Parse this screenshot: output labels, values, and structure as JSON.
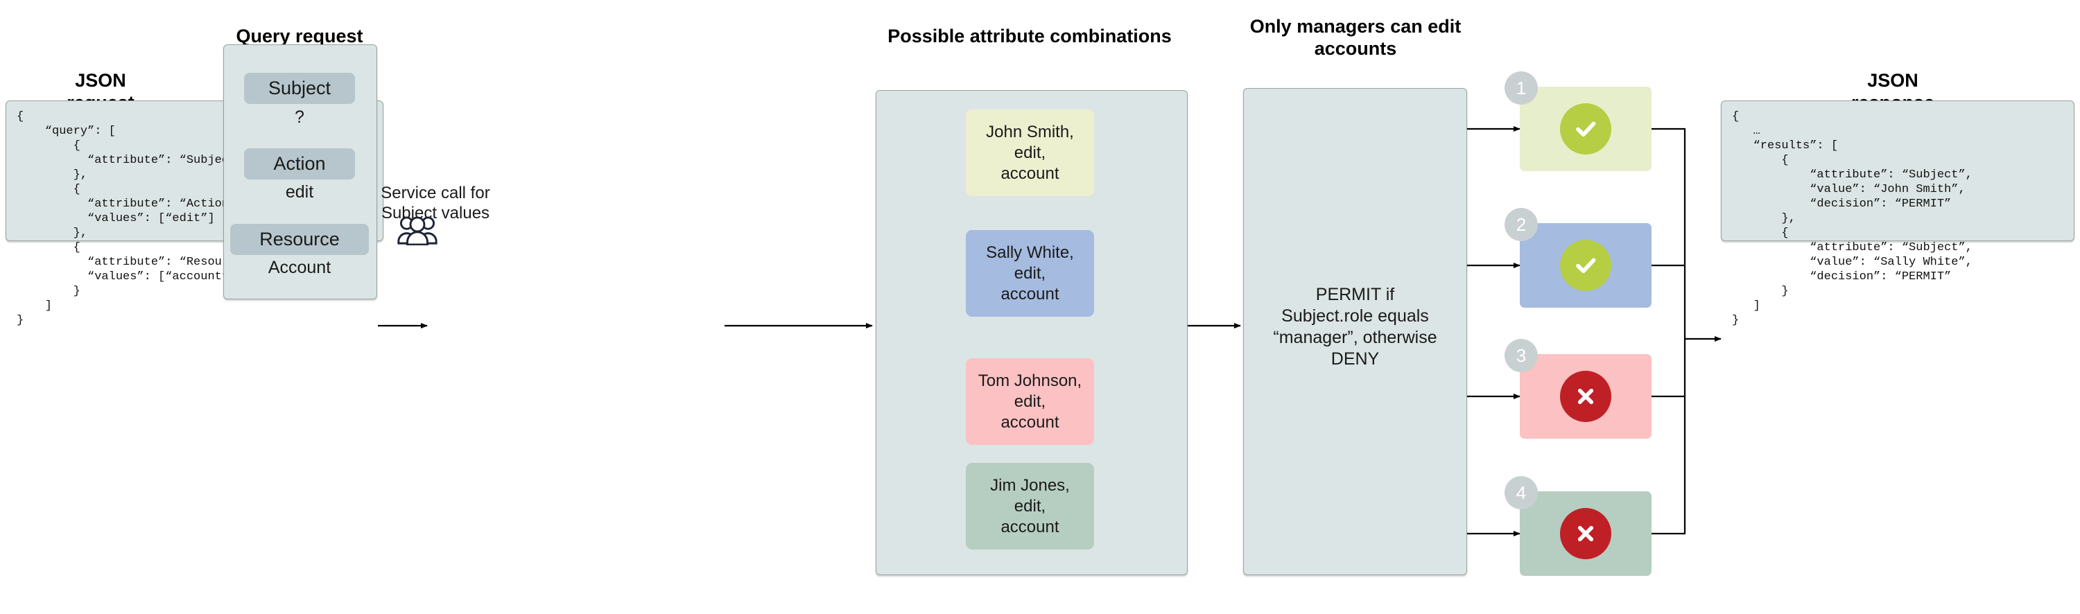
{
  "columns": {
    "json_request_title": "JSON\nrequest",
    "query_request_title": "Query request",
    "combinations_title": "Possible attribute combinations",
    "policy_title": "Only managers can edit\naccounts",
    "json_response_title": "JSON\nresponse"
  },
  "json_request": {
    "code": "{\n    “query”: [\n        {\n          “attribute”: “Subject”\n        },\n        {\n          “attribute”: “Action”,\n          “values”: [“edit”]\n        },\n        {\n          “attribute”: “Resource”,\n          “values”: [“account”]\n        }\n    ]\n}"
  },
  "query_request": {
    "fields": [
      {
        "label": "Subject",
        "value": "?"
      },
      {
        "label": "Action",
        "value": "edit"
      },
      {
        "label": "Resource",
        "value": "Account"
      }
    ]
  },
  "service_call": {
    "label": "Service call for\nSubject values",
    "icon": "users-group-icon",
    "icon_color": "#1b2535"
  },
  "combinations": [
    {
      "text": "John Smith,\nedit,\naccount",
      "color": "#edf0cf"
    },
    {
      "text": "Sally White,\nedit,\naccount",
      "color": "#a5bbe0"
    },
    {
      "text": "Tom Johnson,\nedit,\naccount",
      "color": "#fcc1c2"
    },
    {
      "text": "Jim Jones,\nedit,\naccount",
      "color": "#b6cec1"
    }
  ],
  "policy": {
    "rule": "PERMIT if\nSubject.role equals\n“manager”, otherwise\nDENY"
  },
  "results": [
    {
      "number": "1",
      "card_color": "#e7eecc",
      "decision": "PERMIT",
      "icon": "check-circle-icon",
      "icon_color": "#b5ce43"
    },
    {
      "number": "2",
      "card_color": "#a5bbe0",
      "decision": "PERMIT",
      "icon": "check-circle-icon",
      "icon_color": "#b5ce43"
    },
    {
      "number": "3",
      "card_color": "#fcc1c2",
      "decision": "DENY",
      "icon": "x-circle-icon",
      "icon_color": "#bf2026"
    },
    {
      "number": "4",
      "card_color": "#b6cec1",
      "decision": "DENY",
      "icon": "x-circle-icon",
      "icon_color": "#bf2026"
    }
  ],
  "json_response": {
    "code": "{\n   …\n   “results”: [\n       {\n           “attribute”: “Subject”,\n           “value”: “John Smith”,\n           “decision”: “PERMIT”\n       },\n       {\n           “attribute”: “Subject”,\n           “value”: “Sally White”,\n           “decision”: “PERMIT”\n       }\n   ]\n}"
  },
  "colors": {
    "panel_fill": "#dce5e5",
    "panel_border": "#9aa3a3",
    "field_fill": "#b6c6cc",
    "badge_fill": "#c9d0d2",
    "arrow": "#000000"
  }
}
